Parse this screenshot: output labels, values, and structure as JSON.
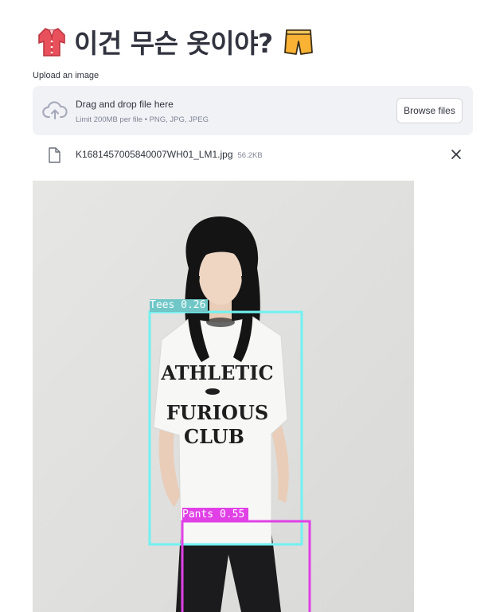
{
  "header": {
    "title": "이건 무슨 옷이야?",
    "leading_icon": "shirt-icon",
    "trailing_icon": "shorts-icon"
  },
  "uploader": {
    "label": "Upload an image",
    "drop_title": "Drag and drop file here",
    "drop_subtitle": "Limit 200MB per file • PNG, JPG, JPEG",
    "browse_label": "Browse files",
    "upload_icon": "cloud-upload-icon"
  },
  "uploaded_file": {
    "name": "K1681457005840007WH01_LM1.jpg",
    "size": "56.2KB",
    "file_icon": "file-icon",
    "remove_icon": "close-icon"
  },
  "result_image": {
    "shirt_print": [
      "ATHLETIC",
      "FURIOUS",
      "CLUB"
    ],
    "detections": [
      {
        "label": "Tees 0.26",
        "color": "#6ff2f2"
      },
      {
        "label": "Pants 0.55",
        "color": "#e040e6"
      }
    ]
  }
}
